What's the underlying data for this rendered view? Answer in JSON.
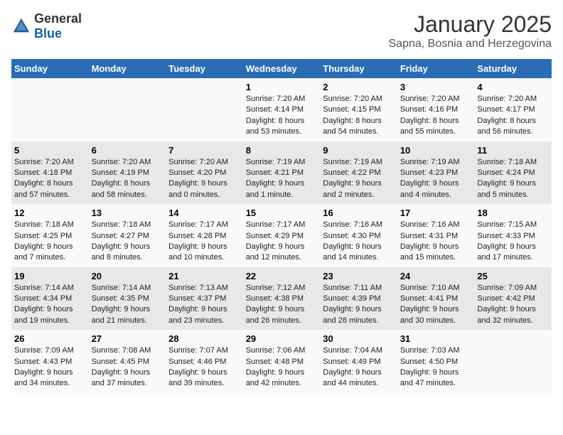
{
  "header": {
    "logo": {
      "general": "General",
      "blue": "Blue"
    },
    "title": "January 2025",
    "subtitle": "Sapna, Bosnia and Herzegovina"
  },
  "weekdays": [
    "Sunday",
    "Monday",
    "Tuesday",
    "Wednesday",
    "Thursday",
    "Friday",
    "Saturday"
  ],
  "weeks": [
    [
      {
        "day": "",
        "info": ""
      },
      {
        "day": "",
        "info": ""
      },
      {
        "day": "",
        "info": ""
      },
      {
        "day": "1",
        "info": "Sunrise: 7:20 AM\nSunset: 4:14 PM\nDaylight: 8 hours and 53 minutes."
      },
      {
        "day": "2",
        "info": "Sunrise: 7:20 AM\nSunset: 4:15 PM\nDaylight: 8 hours and 54 minutes."
      },
      {
        "day": "3",
        "info": "Sunrise: 7:20 AM\nSunset: 4:16 PM\nDaylight: 8 hours and 55 minutes."
      },
      {
        "day": "4",
        "info": "Sunrise: 7:20 AM\nSunset: 4:17 PM\nDaylight: 8 hours and 56 minutes."
      }
    ],
    [
      {
        "day": "5",
        "info": "Sunrise: 7:20 AM\nSunset: 4:18 PM\nDaylight: 8 hours and 57 minutes."
      },
      {
        "day": "6",
        "info": "Sunrise: 7:20 AM\nSunset: 4:19 PM\nDaylight: 8 hours and 58 minutes."
      },
      {
        "day": "7",
        "info": "Sunrise: 7:20 AM\nSunset: 4:20 PM\nDaylight: 9 hours and 0 minutes."
      },
      {
        "day": "8",
        "info": "Sunrise: 7:19 AM\nSunset: 4:21 PM\nDaylight: 9 hours and 1 minute."
      },
      {
        "day": "9",
        "info": "Sunrise: 7:19 AM\nSunset: 4:22 PM\nDaylight: 9 hours and 2 minutes."
      },
      {
        "day": "10",
        "info": "Sunrise: 7:19 AM\nSunset: 4:23 PM\nDaylight: 9 hours and 4 minutes."
      },
      {
        "day": "11",
        "info": "Sunrise: 7:18 AM\nSunset: 4:24 PM\nDaylight: 9 hours and 5 minutes."
      }
    ],
    [
      {
        "day": "12",
        "info": "Sunrise: 7:18 AM\nSunset: 4:25 PM\nDaylight: 9 hours and 7 minutes."
      },
      {
        "day": "13",
        "info": "Sunrise: 7:18 AM\nSunset: 4:27 PM\nDaylight: 9 hours and 8 minutes."
      },
      {
        "day": "14",
        "info": "Sunrise: 7:17 AM\nSunset: 4:28 PM\nDaylight: 9 hours and 10 minutes."
      },
      {
        "day": "15",
        "info": "Sunrise: 7:17 AM\nSunset: 4:29 PM\nDaylight: 9 hours and 12 minutes."
      },
      {
        "day": "16",
        "info": "Sunrise: 7:16 AM\nSunset: 4:30 PM\nDaylight: 9 hours and 14 minutes."
      },
      {
        "day": "17",
        "info": "Sunrise: 7:16 AM\nSunset: 4:31 PM\nDaylight: 9 hours and 15 minutes."
      },
      {
        "day": "18",
        "info": "Sunrise: 7:15 AM\nSunset: 4:33 PM\nDaylight: 9 hours and 17 minutes."
      }
    ],
    [
      {
        "day": "19",
        "info": "Sunrise: 7:14 AM\nSunset: 4:34 PM\nDaylight: 9 hours and 19 minutes."
      },
      {
        "day": "20",
        "info": "Sunrise: 7:14 AM\nSunset: 4:35 PM\nDaylight: 9 hours and 21 minutes."
      },
      {
        "day": "21",
        "info": "Sunrise: 7:13 AM\nSunset: 4:37 PM\nDaylight: 9 hours and 23 minutes."
      },
      {
        "day": "22",
        "info": "Sunrise: 7:12 AM\nSunset: 4:38 PM\nDaylight: 9 hours and 26 minutes."
      },
      {
        "day": "23",
        "info": "Sunrise: 7:11 AM\nSunset: 4:39 PM\nDaylight: 9 hours and 28 minutes."
      },
      {
        "day": "24",
        "info": "Sunrise: 7:10 AM\nSunset: 4:41 PM\nDaylight: 9 hours and 30 minutes."
      },
      {
        "day": "25",
        "info": "Sunrise: 7:09 AM\nSunset: 4:42 PM\nDaylight: 9 hours and 32 minutes."
      }
    ],
    [
      {
        "day": "26",
        "info": "Sunrise: 7:09 AM\nSunset: 4:43 PM\nDaylight: 9 hours and 34 minutes."
      },
      {
        "day": "27",
        "info": "Sunrise: 7:08 AM\nSunset: 4:45 PM\nDaylight: 9 hours and 37 minutes."
      },
      {
        "day": "28",
        "info": "Sunrise: 7:07 AM\nSunset: 4:46 PM\nDaylight: 9 hours and 39 minutes."
      },
      {
        "day": "29",
        "info": "Sunrise: 7:06 AM\nSunset: 4:48 PM\nDaylight: 9 hours and 42 minutes."
      },
      {
        "day": "30",
        "info": "Sunrise: 7:04 AM\nSunset: 4:49 PM\nDaylight: 9 hours and 44 minutes."
      },
      {
        "day": "31",
        "info": "Sunrise: 7:03 AM\nSunset: 4:50 PM\nDaylight: 9 hours and 47 minutes."
      },
      {
        "day": "",
        "info": ""
      }
    ]
  ]
}
